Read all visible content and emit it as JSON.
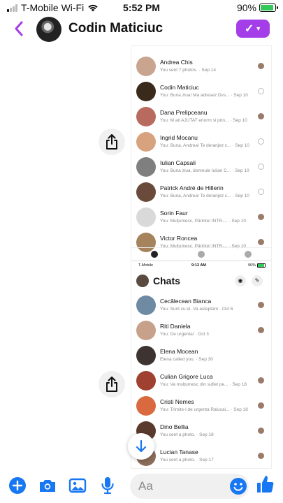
{
  "status_bar": {
    "carrier": "T-Mobile Wi-Fi",
    "time": "5:52 PM",
    "battery": "90%"
  },
  "header": {
    "title": "Codin Maticiuc"
  },
  "chats_a": [
    {
      "name": "Andrea Chis",
      "preview": "You sent 7 photos. · Sep 14",
      "avatar_color": "#c9a48e",
      "indicator": "face"
    },
    {
      "name": "Codin Maticiuc",
      "preview": "You: Buna ziua! Ma adresez Dvs... · Sep 10",
      "avatar_color": "#3a2a1c",
      "indicator": "ring"
    },
    {
      "name": "Dana Prelipceanu",
      "preview": "You: M ati AJUTAT enorm si prin... · Sep 10",
      "avatar_color": "#b86a5e",
      "indicator": "face"
    },
    {
      "name": "Ingrid Mocanu",
      "preview": "You: Buna, Andrea! Te deranjez c... · Sep 10",
      "avatar_color": "#d7a37f",
      "indicator": "ring"
    },
    {
      "name": "Iulian Capsali",
      "preview": "You: Buna ziua, domnule Iulian C... · Sep 10",
      "avatar_color": "#7f7f7f",
      "indicator": "ring"
    },
    {
      "name": "Patrick André de Hillerin",
      "preview": "You: Buna, Andrea! Te deranjez c... · Sep 10",
      "avatar_color": "#6a4a3a",
      "indicator": "ring"
    },
    {
      "name": "Sorin Faur",
      "preview": "You: Mulțumesc, Părinte! INTR-... · Sep 10",
      "avatar_color": "#d9d9d9",
      "indicator": "face"
    },
    {
      "name": "Victor Roncea",
      "preview": "You: Mulțumesc, Părinte! INTR-... · Sep 10",
      "avatar_color": "#a5835c",
      "indicator": "face"
    }
  ],
  "mini_status": {
    "carrier": "T-Mobile",
    "time": "9:12 AM",
    "battery": "96%"
  },
  "chats_b_title": "Chats",
  "chats_b": [
    {
      "name": "Cecălecean Bianca",
      "preview": "You: Sunt cu el. Va asteptam · Oct 6",
      "avatar_color": "#6f8aa3",
      "indicator": "face"
    },
    {
      "name": "Riti Daniela",
      "preview": "You: De urgenta! · Oct 3",
      "avatar_color": "#c7a18a",
      "indicator": "face"
    },
    {
      "name": "Elena Mocean",
      "preview": "Elena called you. · Sep 30",
      "avatar_color": "#3d3432",
      "indicator": "none"
    },
    {
      "name": "Culian Grigore Luca",
      "preview": "You: Va mulțumesc din suflet pe... · Sep 18",
      "avatar_color": "#a04030",
      "indicator": "face"
    },
    {
      "name": "Cristi Nemes",
      "preview": "You: Trimite-l de urgenta Ralucai... · Sep 18",
      "avatar_color": "#d96a40",
      "indicator": "face"
    },
    {
      "name": "Dino Bellia",
      "preview": "You sent a photo. · Sep 18",
      "avatar_color": "#5a3a2c",
      "indicator": "face"
    },
    {
      "name": "Lucian Tanase",
      "preview": "You sent a photo. · Sep 17",
      "avatar_color": "#8a6c58",
      "indicator": "face"
    }
  ],
  "composer": {
    "placeholder": "Aa"
  },
  "colors": {
    "accent": "#a33ee8",
    "messenger_blue": "#1877f2"
  }
}
